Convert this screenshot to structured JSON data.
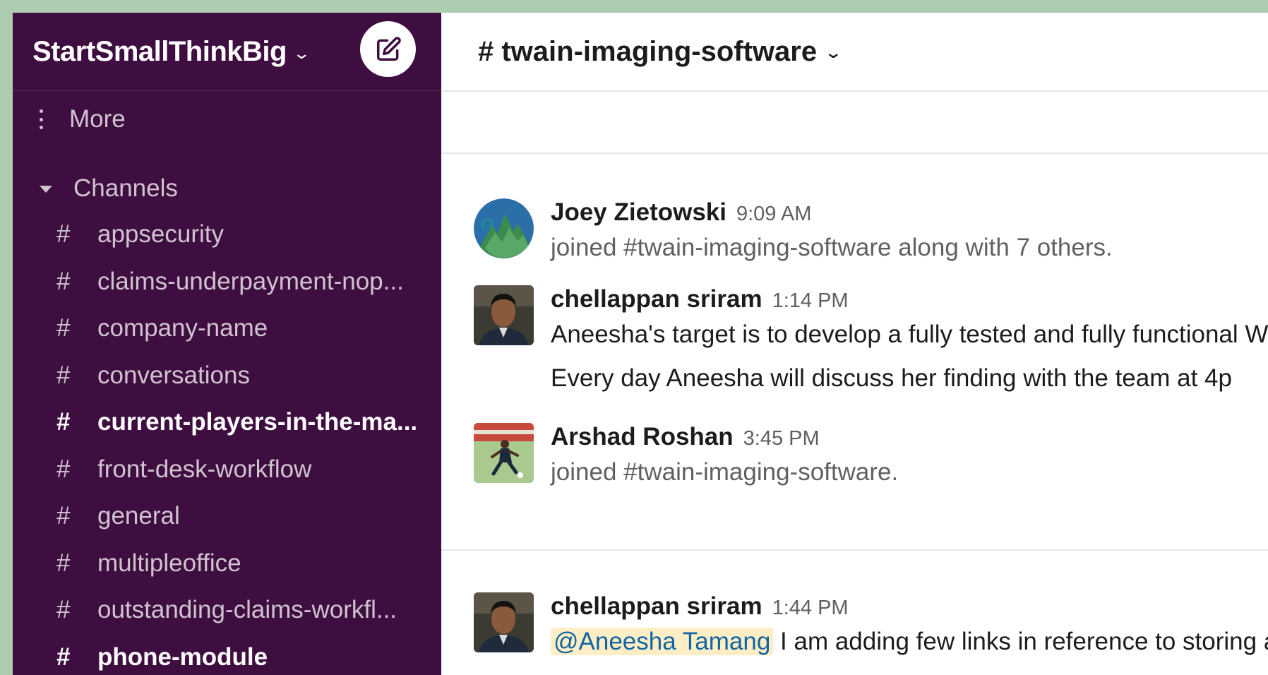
{
  "sidebar": {
    "workspace_name": "StartSmallThinkBig",
    "more_label": "More",
    "channels_section_label": "Channels",
    "channels": [
      {
        "name": "appsecurity",
        "bold": false
      },
      {
        "name": "claims-underpayment-nop...",
        "bold": false
      },
      {
        "name": "company-name",
        "bold": false
      },
      {
        "name": "conversations",
        "bold": false
      },
      {
        "name": "current-players-in-the-ma...",
        "bold": true
      },
      {
        "name": "front-desk-workflow",
        "bold": false
      },
      {
        "name": "general",
        "bold": false
      },
      {
        "name": "multipleoffice",
        "bold": false
      },
      {
        "name": "outstanding-claims-workfl...",
        "bold": false
      },
      {
        "name": "phone-module",
        "bold": true
      }
    ],
    "hash": "#"
  },
  "channel_header": {
    "title": "# twain-imaging-software"
  },
  "messages": [
    {
      "sender": "Joey Zietowski",
      "time": "9:09 AM",
      "avatar": "mountain-logo-avatar",
      "lines": [
        "joined #twain-imaging-software along with 7 others."
      ]
    },
    {
      "sender": "chellappan sriram",
      "time": "1:14 PM",
      "avatar": "person-photo-avatar",
      "lines": [
        "Aneesha's target is to develop a fully tested and fully functional W",
        "Every day Aneesha will discuss her finding with the team at 4p"
      ]
    },
    {
      "sender": "Arshad Roshan",
      "time": "3:45 PM",
      "avatar": "soccer-photo-avatar",
      "lines": [
        "joined #twain-imaging-software."
      ]
    },
    {
      "sender": "chellappan sriram",
      "time": "1:44 PM",
      "avatar": "person-photo-avatar",
      "mention": "@Aneesha Tamang",
      "lines": [
        " I am adding few links in reference to storing a"
      ]
    }
  ],
  "colors": {
    "sidebar_bg": "#3f0e40",
    "mention_bg": "#fdeec6",
    "mention_text": "#1264a3"
  }
}
